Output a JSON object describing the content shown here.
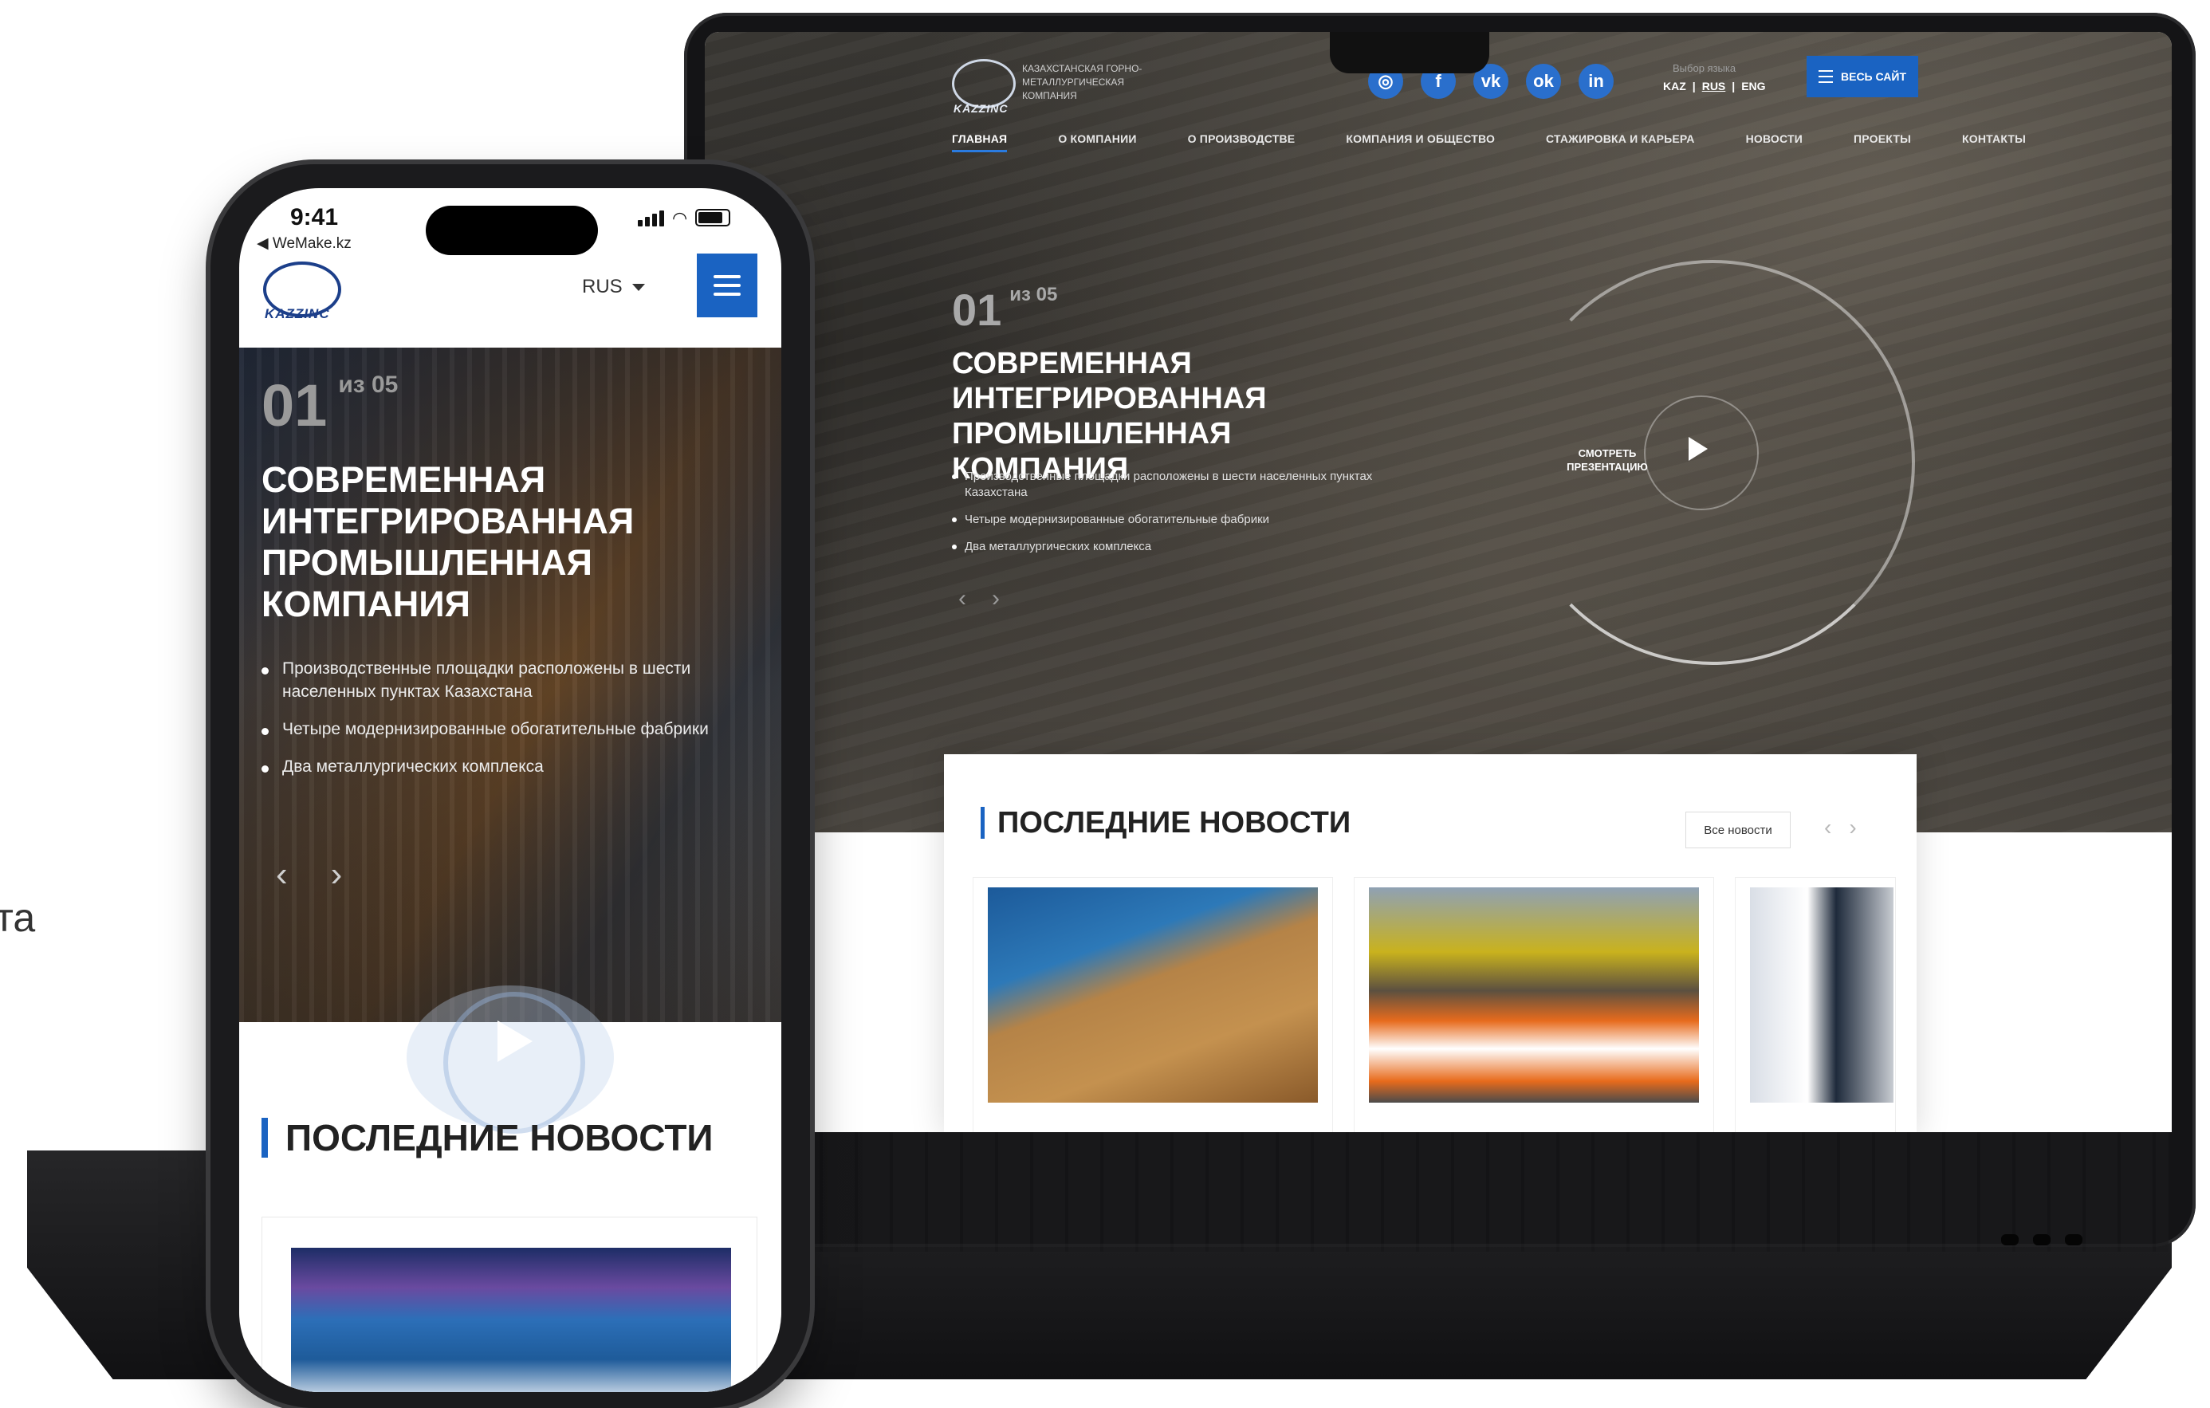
{
  "stray_text": "та",
  "laptop": {
    "company_line": "КАЗАХСТАНСКАЯ ГОРНО-МЕТАЛЛУРГИЧЕСКАЯ КОМПАНИЯ",
    "logo_word": "KAZZINC",
    "social_icons": [
      "instagram-icon",
      "facebook-icon",
      "vk-icon",
      "odnoklassniki-icon",
      "linkedin-icon"
    ],
    "lang_title": "Выбор языка",
    "lang_options": [
      "KAZ",
      "RUS",
      "ENG"
    ],
    "lang_separator": "|",
    "full_site_label": "ВЕСЬ САЙТ",
    "nav": [
      "ГЛАВНАЯ",
      "О КОМПАНИИ",
      "О ПРОИЗВОДСТВЕ",
      "КОМПАНИЯ И ОБЩЕСТВО",
      "СТАЖИРОВКА И КАРЬЕРА",
      "НОВОСТИ",
      "ПРОЕКТЫ",
      "КОНТАКТЫ"
    ],
    "slide_current": "01",
    "slide_total": "из 05",
    "hero_title": "СОВРЕМЕННАЯ ИНТЕГРИРОВАННАЯ ПРОМЫШЛЕННАЯ КОМПАНИЯ",
    "bullets": [
      "Производственные площадки расположены в шести населенных пунктах Казахстана",
      "Четыре модернизированные обогатительные фабрики",
      "Два металлургических комплекса"
    ],
    "watch_label": "СМОТРЕТЬ ПРЕЗЕНТАЦИЮ",
    "arrow_prev": "‹",
    "arrow_next": "›",
    "news_title": "ПОСЛЕДНИЕ НОВОСТИ",
    "all_news": "Все новости"
  },
  "phone": {
    "time": "9:41",
    "back_label": "◀ WeMake.kz",
    "logo_word": "KAZZINC",
    "lang": "RUS",
    "slide_current": "01",
    "slide_total": "из 05",
    "hero_title": "СОВРЕМЕННАЯ ИНТЕГРИРОВАННАЯ ПРОМЫШЛЕННАЯ КОМПАНИЯ",
    "bullets": [
      "Производственные площадки расположены в шести населенных пунктах Казахстана",
      "Четыре модернизированные обогатительные фабрики",
      "Два металлургических комплекса"
    ],
    "arrow_prev": "‹",
    "arrow_next": "›",
    "news_title": "ПОСЛЕДНИЕ НОВОСТИ"
  },
  "colors": {
    "accent": "#1a63c2",
    "hero_dark": "#2e2c29",
    "text_dark": "#222222"
  }
}
